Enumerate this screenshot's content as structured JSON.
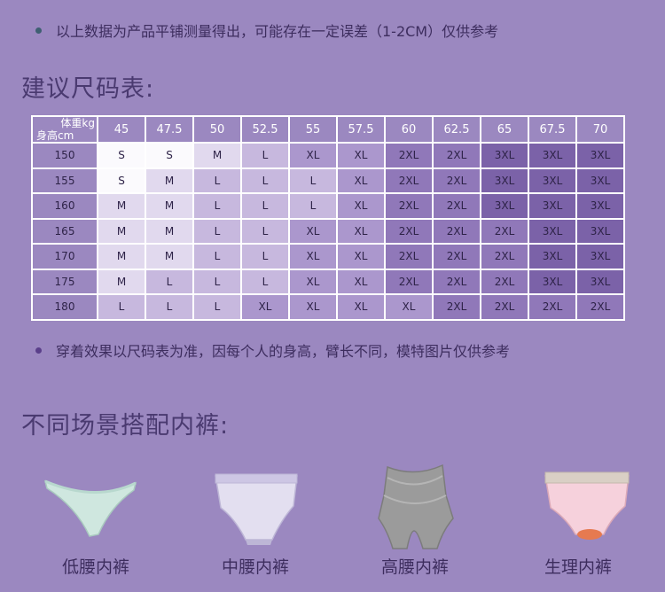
{
  "notes": {
    "measure_note": "以上数据为产品平铺测量得出，可能存在一定误差（1-2CM）仅供参考",
    "fit_note": "穿着效果以尺码表为准，因每个人的身高，臂长不同，模特图片仅供参考"
  },
  "headings": {
    "size_chart": "建议尺码表:",
    "matching": "不同场景搭配内裤:"
  },
  "size_table": {
    "corner_weight": "体重kg",
    "corner_height": "身高cm",
    "weights": [
      "45",
      "47.5",
      "50",
      "52.5",
      "55",
      "57.5",
      "60",
      "62.5",
      "65",
      "67.5",
      "70"
    ],
    "rows": [
      {
        "height": "150",
        "sizes": [
          "S",
          "S",
          "M",
          "L",
          "XL",
          "XL",
          "2XL",
          "2XL",
          "3XL",
          "3XL",
          "3XL"
        ]
      },
      {
        "height": "155",
        "sizes": [
          "S",
          "M",
          "L",
          "L",
          "L",
          "XL",
          "2XL",
          "2XL",
          "3XL",
          "3XL",
          "3XL"
        ]
      },
      {
        "height": "160",
        "sizes": [
          "M",
          "M",
          "L",
          "L",
          "L",
          "XL",
          "2XL",
          "2XL",
          "3XL",
          "3XL",
          "3XL"
        ]
      },
      {
        "height": "165",
        "sizes": [
          "M",
          "M",
          "L",
          "L",
          "XL",
          "XL",
          "2XL",
          "2XL",
          "2XL",
          "3XL",
          "3XL"
        ]
      },
      {
        "height": "170",
        "sizes": [
          "M",
          "M",
          "L",
          "L",
          "XL",
          "XL",
          "2XL",
          "2XL",
          "2XL",
          "3XL",
          "3XL"
        ]
      },
      {
        "height": "175",
        "sizes": [
          "M",
          "L",
          "L",
          "L",
          "XL",
          "XL",
          "2XL",
          "2XL",
          "2XL",
          "3XL",
          "3XL"
        ]
      },
      {
        "height": "180",
        "sizes": [
          "L",
          "L",
          "L",
          "XL",
          "XL",
          "XL",
          "XL",
          "2XL",
          "2XL",
          "2XL",
          "2XL"
        ]
      }
    ]
  },
  "products": [
    {
      "icon": "low-waist-brief-icon",
      "label": "低腰内裤"
    },
    {
      "icon": "mid-waist-brief-icon",
      "label": "中腰内裤"
    },
    {
      "icon": "high-waist-brief-icon",
      "label": "高腰内裤"
    },
    {
      "icon": "period-brief-icon",
      "label": "生理内裤"
    }
  ]
}
